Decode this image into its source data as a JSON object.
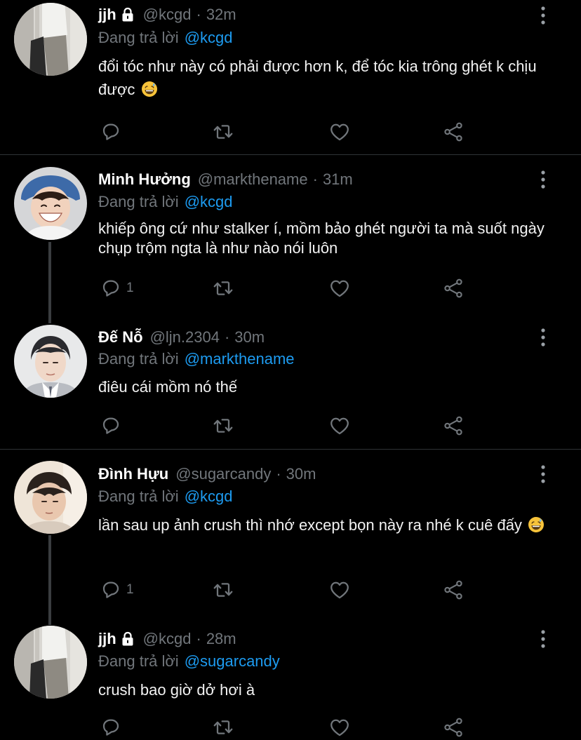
{
  "reply_prefix": "Đang trả lời",
  "separator": "·",
  "tweets": [
    {
      "name": "jjh",
      "locked": true,
      "handle": "@kcgd",
      "time": "32m",
      "reply_to": "@kcgd",
      "text": "đổi tóc như này có phải được hơn k, để tóc kia trông ghét k chịu được",
      "emoji": "grinning-sweat-emoji",
      "replies": ""
    },
    {
      "name": "Minh Hưởng",
      "locked": false,
      "handle": "@markthename",
      "time": "31m",
      "reply_to": "@kcgd",
      "text": "khiếp ông cứ như stalker í, mồm bảo ghét người ta mà suốt ngày chụp trộm ngta là như nào nói luôn",
      "emoji": "",
      "replies": "1"
    },
    {
      "name": "Đế Nỗ",
      "locked": false,
      "handle": "@ljn.2304",
      "time": "30m",
      "reply_to": "@markthename",
      "text": "điêu cái mồm nó thế",
      "emoji": "",
      "replies": ""
    },
    {
      "name": "Đình Hựu",
      "locked": false,
      "handle": "@sugarcandy",
      "time": "30m",
      "reply_to": "@kcgd",
      "text": "lần sau up ảnh crush thì nhớ except bọn này ra nhé k cuê đấy",
      "emoji": "grinning-sweat-emoji",
      "replies": "1"
    },
    {
      "name": "jjh",
      "locked": true,
      "handle": "@kcgd",
      "time": "28m",
      "reply_to": "@sugarcandy",
      "text": "crush bao giờ dở hơi à",
      "emoji": "",
      "replies": ""
    }
  ],
  "icons": {
    "reply": "reply-icon",
    "retweet": "retweet-icon",
    "like": "heart-icon",
    "share": "share-icon",
    "more": "more-vertical-icon",
    "lock": "lock-icon"
  },
  "colors": {
    "background": "#000000",
    "mention": "#1d9bf0",
    "muted": "#71767b",
    "divider": "#2f3336"
  }
}
